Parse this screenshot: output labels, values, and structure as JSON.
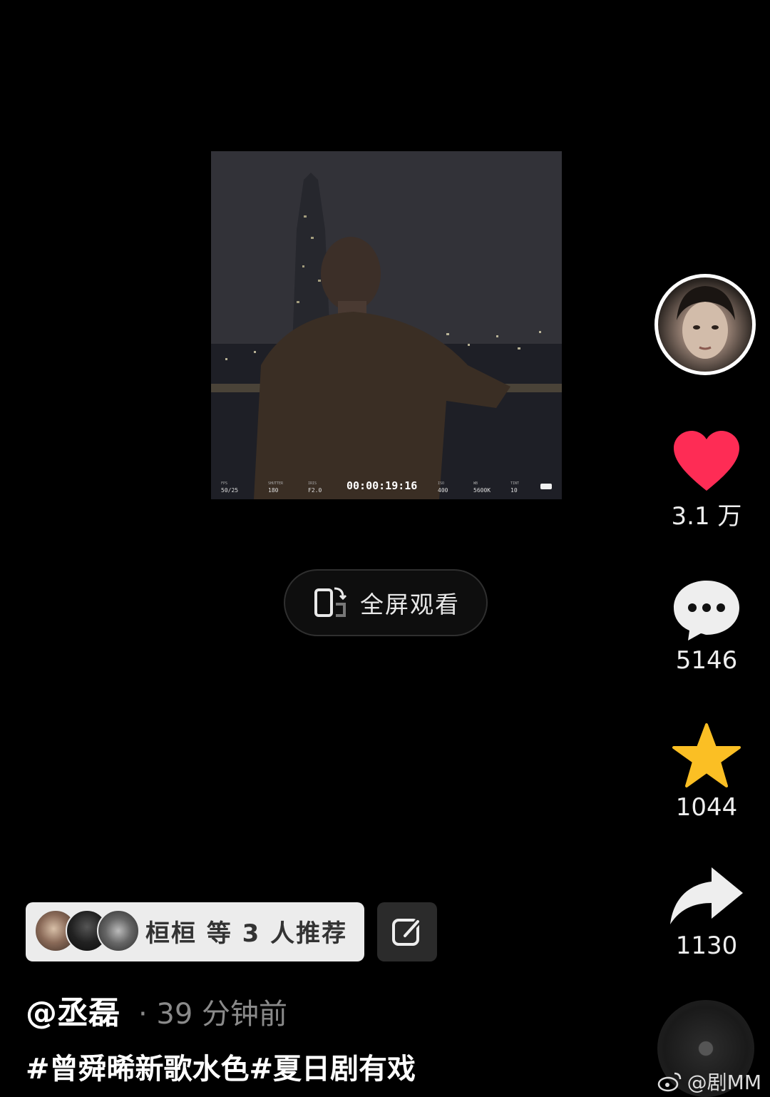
{
  "video": {
    "hud": {
      "fps_label": "FPS",
      "fps_value": "50/25",
      "shutter_label": "SHUTTER",
      "shutter_value": "180",
      "iris_label": "IRIS",
      "iris_value": "F2.0",
      "timecode": "00:00:19:16",
      "iso_label": "ISO",
      "iso_value": "400",
      "wb_label": "WB",
      "wb_value": "5600K",
      "tint_label": "TINT",
      "tint_value": "10"
    }
  },
  "fullscreen_button": {
    "label": "全屏观看",
    "icon": "rotate-phone-icon"
  },
  "side_rail": {
    "avatar": {
      "icon": "creator-avatar"
    },
    "like": {
      "count": "3.1 万",
      "icon": "heart-icon",
      "color": "#fe2c55"
    },
    "comment": {
      "count": "5146",
      "icon": "comment-bubble-icon"
    },
    "favorite": {
      "count": "1044",
      "icon": "star-icon",
      "color": "#fbbf24"
    },
    "share": {
      "count": "1130",
      "icon": "share-arrow-icon"
    },
    "music": {
      "icon": "music-disc-icon"
    }
  },
  "recommend": {
    "text": "桓桓 等 3 人推荐",
    "edit_icon": "edit-icon"
  },
  "post": {
    "author": "@丞磊",
    "time_ago": "· 39 分钟前",
    "hashtags": "#曾舜晞新歌水色#夏日剧有戏"
  },
  "watermark": {
    "text": "@剧MM",
    "icon": "weibo-icon"
  }
}
